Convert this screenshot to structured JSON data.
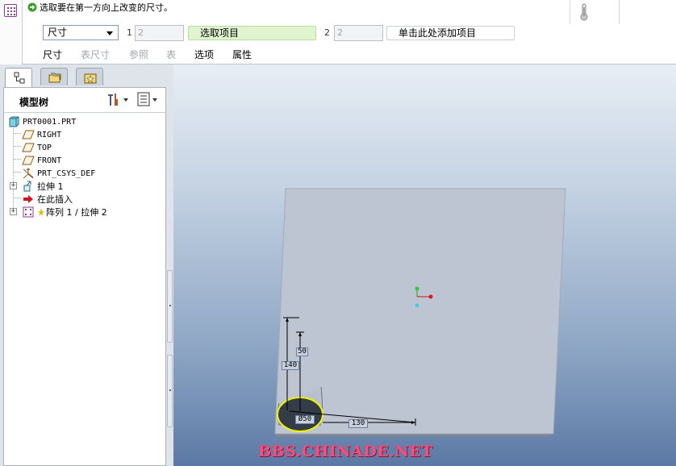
{
  "dashboard": {
    "prompt": "选取要在第一方向上改变的尺寸。",
    "dimension_dropdown": "尺寸",
    "direction1": {
      "index": "1",
      "count": "2",
      "collector": "选取项目"
    },
    "direction2": {
      "index": "2",
      "count": "2",
      "collector": "单击此处添加项目"
    },
    "tabs": [
      {
        "label": "尺寸",
        "enabled": true
      },
      {
        "label": "表尺寸",
        "enabled": false
      },
      {
        "label": "参照",
        "enabled": false
      },
      {
        "label": "表",
        "enabled": false
      },
      {
        "label": "选项",
        "enabled": true
      },
      {
        "label": "属性",
        "enabled": true
      }
    ]
  },
  "navigator": {
    "tabs": [
      "model-tree-icon",
      "folder-browser-icon",
      "favorites-icon"
    ],
    "title": "模型树",
    "tree": [
      {
        "label": "PRT0001.PRT",
        "icon": "part-icon"
      },
      {
        "label": "RIGHT",
        "icon": "datum-plane-icon"
      },
      {
        "label": "TOP",
        "icon": "datum-plane-icon"
      },
      {
        "label": "FRONT",
        "icon": "datum-plane-icon"
      },
      {
        "label": "PRT_CSYS_DEF",
        "icon": "csys-icon"
      },
      {
        "label": "拉伸 1",
        "icon": "extrude-icon"
      },
      {
        "label": "在此插入",
        "icon": "insert-here-arrow-icon"
      },
      {
        "label": "阵列 1 / 拉伸 2",
        "icon": "pattern-icon"
      }
    ]
  },
  "graphics": {
    "dimensions": [
      "140",
      "50",
      "130",
      "Ø50"
    ],
    "watermark": "BBS.CHINADE.NET"
  },
  "colors": {
    "collector_active": "#e0f5cf",
    "watermark": "#ff4a7a",
    "dimension_box": "#6f7fa6"
  }
}
